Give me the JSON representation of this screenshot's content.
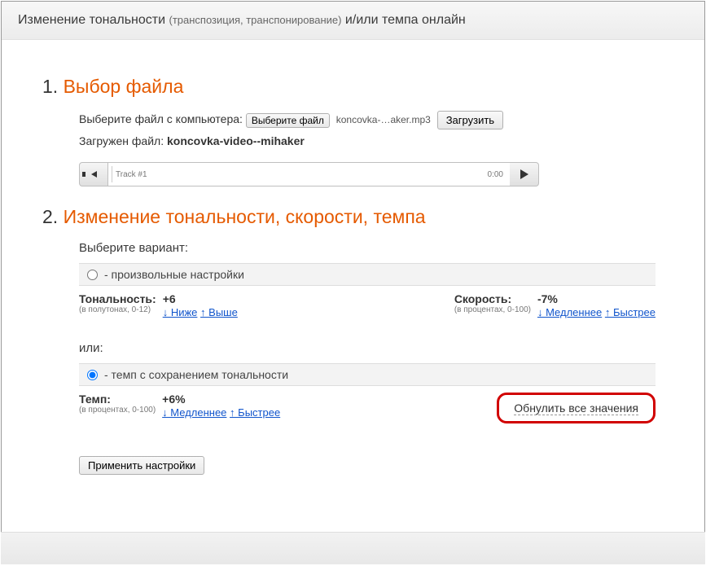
{
  "header": {
    "title_part1": "Изменение тональности ",
    "title_paren": "(транспозиция, транспонирование)",
    "title_part2": " и/или темпа онлайн"
  },
  "section1": {
    "number": "1. ",
    "title": "Выбор файла",
    "select_label": "Выберите файл с компьютера: ",
    "choose_button": "Выберите файл",
    "filename_display": "koncovka-…aker.mp3",
    "upload_button": "Загрузить",
    "loaded_label": "Загружен файл: ",
    "loaded_filename": "koncovka-video--mihaker",
    "player": {
      "track_label": "Track #1",
      "time": "0:00"
    }
  },
  "section2": {
    "number": "2. ",
    "title": "Изменение тональности, скорости, темпа",
    "variant_label": "Выберите вариант:",
    "option_custom": " - произвольные настройки",
    "pitch": {
      "label": "Тональность:",
      "sublabel": "(в полутонах, 0-12)",
      "value": "+6",
      "lower": "↓ Ниже",
      "higher": "↑ Выше"
    },
    "speed": {
      "label": "Скорость:",
      "sublabel": "(в процентах, 0-100)",
      "value": "-7%",
      "slower": "↓ Медленнее",
      "faster": "↑ Быстрее"
    },
    "or_label": "или:",
    "option_tempo": " - темп с сохранением тональности",
    "tempo": {
      "label": "Темп:",
      "sublabel": "(в процентах, 0-100)",
      "value": "+6%",
      "slower": "↓ Медленнее",
      "faster": "↑ Быстрее"
    },
    "reset_label": "Обнулить все значения",
    "apply_button": "Применить настройки"
  }
}
